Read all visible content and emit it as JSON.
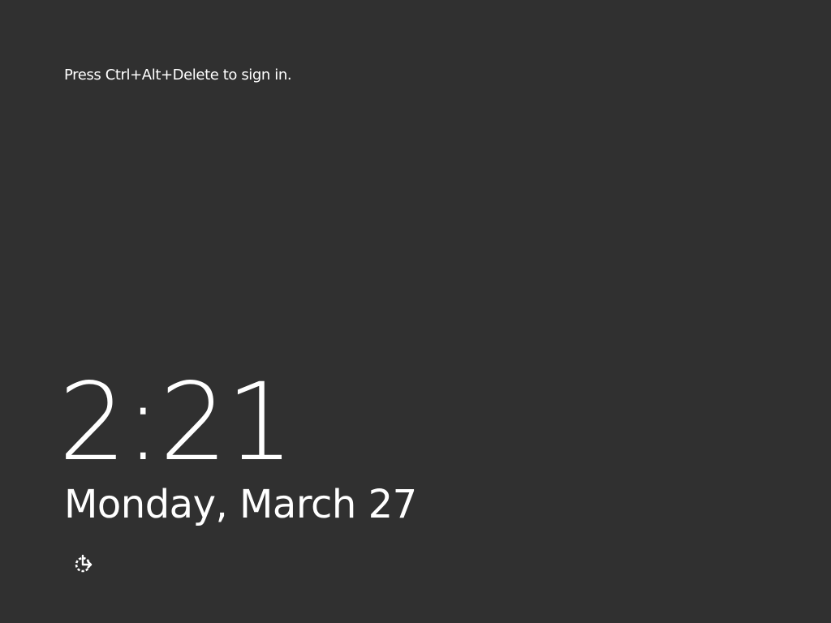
{
  "lock_screen": {
    "prompt": "Press Ctrl+Alt+Delete to sign in.",
    "time": "2:21",
    "date": "Monday, March 27",
    "accessibility_icon": "ease-of-access-icon",
    "background_color": "#303030",
    "text_color": "#ffffff"
  }
}
